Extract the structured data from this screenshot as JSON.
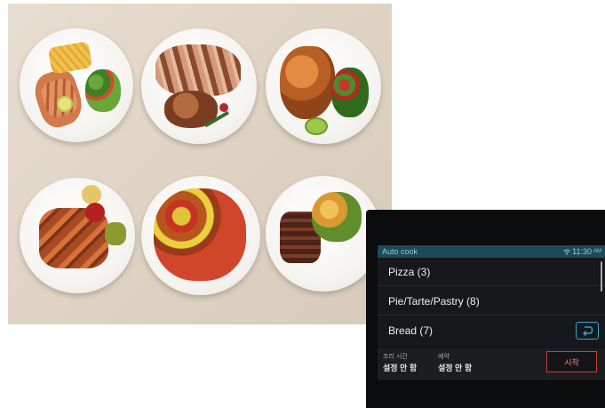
{
  "photo": {
    "alt_description_hidden": "",
    "plates": [
      "salmon-fries-plate",
      "roast-pork-plate",
      "roast-chicken-plate",
      "skewers-plate",
      "sausage-peppers-plate",
      "steak-potatoes-plate"
    ]
  },
  "display": {
    "status_title": "Auto cook",
    "status_time": "11:30",
    "status_ampm": "AM",
    "menu_items": [
      {
        "label": "Pizza (3)"
      },
      {
        "label": "Pie/Tarte/Pastry (8)"
      },
      {
        "label": "Bread (7)"
      }
    ],
    "cook_time_label": "조리 시간",
    "cook_time_value": "설정 안 함",
    "reserve_label": "예약",
    "reserve_value": "설정 안 함",
    "start_label": "시작",
    "icons": {
      "wifi": "wifi-icon",
      "back": "back-arrow-icon"
    },
    "colors": {
      "status_bar": "#1d4a57",
      "accent": "#3aa5c7",
      "start_border": "#c2403a"
    }
  }
}
